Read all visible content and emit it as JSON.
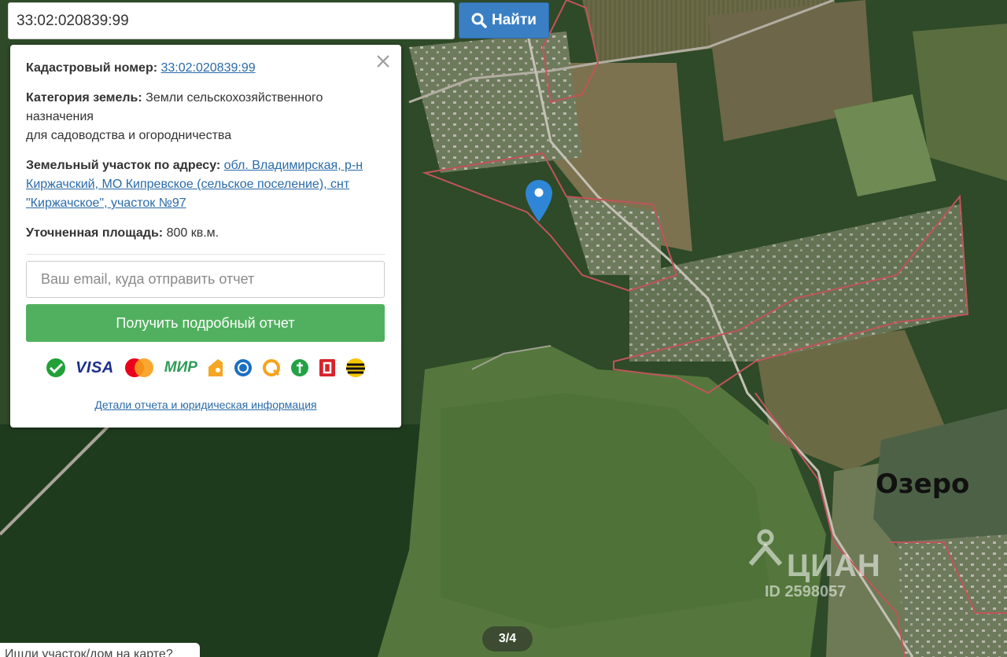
{
  "search": {
    "value": "33:02:020839:99",
    "button_label": "Найти"
  },
  "panel": {
    "cadastral_label": "Кадастровый номер:",
    "cadastral_value": "33:02:020839:99",
    "category_label": "Категория земель:",
    "category_value_line1": "Земли сельскохозяйственного назначения",
    "category_value_line2": "для садоводства и огородничества",
    "address_label": "Земельный участок по адресу:",
    "address_value": "обл. Владимирская, р-н Киржачский, МО Кипревское (сельское поселение), снт \"Киржачское\", участок №97",
    "area_label": "Уточненная площадь:",
    "area_value": "800 кв.м.",
    "email_placeholder": "Ваш email, куда отправить отчет",
    "report_button": "Получить подробный отчет",
    "payment_methods": [
      "sberbank-icon",
      "VISA",
      "mastercard-icon",
      "МИР",
      "yandex-money-icon",
      "webmoney-icon",
      "qiwi-icon",
      "evroset-icon",
      "alfa-bank-icon",
      "beeline-icon"
    ],
    "details_link": "Детали отчета и юридическая информация"
  },
  "map": {
    "lake_label": "Озеро",
    "watermark_brand": "ЦИАН",
    "watermark_id": "ID 2598057",
    "photo_counter": "3/4",
    "corner_label": "Ищли участок/дом на карте?"
  },
  "colors": {
    "search_button": "#3a7fc4",
    "report_button": "#51b05f",
    "link": "#2a6aa8",
    "pin": "#2f86d6",
    "boundary": "#c0545a"
  }
}
